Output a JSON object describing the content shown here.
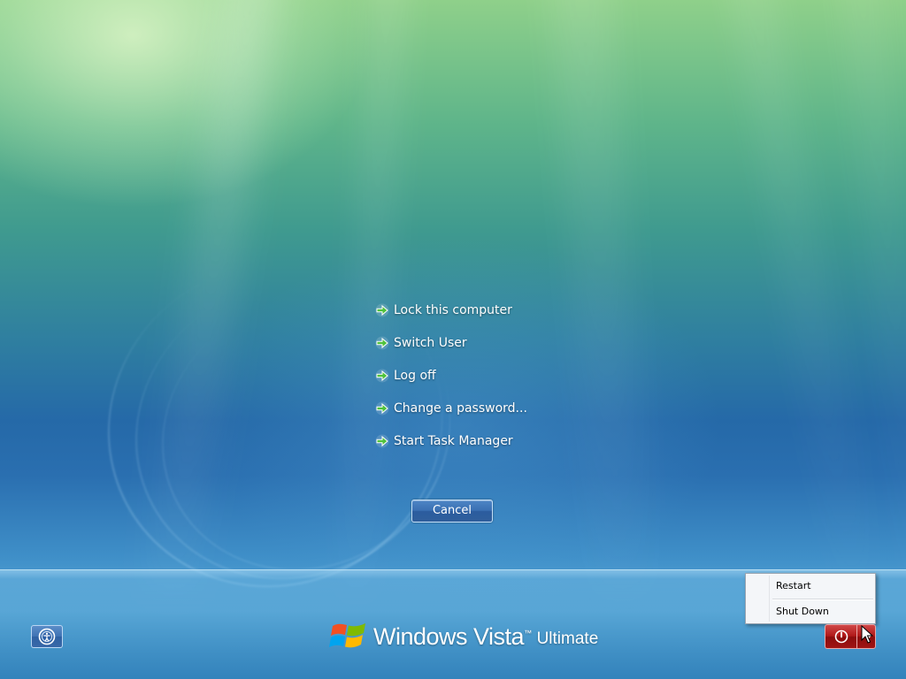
{
  "options": [
    {
      "label": "Lock this computer"
    },
    {
      "label": "Switch User"
    },
    {
      "label": "Log off"
    },
    {
      "label": "Change a password..."
    },
    {
      "label": "Start Task Manager"
    }
  ],
  "cancel_label": "Cancel",
  "branding": {
    "name": "Windows Vista",
    "trademark": "™",
    "edition": "Ultimate"
  },
  "power_menu": {
    "items": [
      {
        "label": "Restart"
      },
      {
        "label": "Shut Down"
      }
    ]
  },
  "icons": {
    "option_arrow": "green-arrow-icon",
    "ease_of_access": "ease-of-access-icon",
    "power": "power-icon",
    "menu_arrow": "chevron-down-icon",
    "logo": "windows-flag-logo",
    "cursor": "mouse-cursor"
  },
  "colors": {
    "arrow_green": "#4fc23c",
    "power_red": "#b01818",
    "button_blue": "#3a6fb2",
    "menu_bg": "#f4f6f9"
  }
}
